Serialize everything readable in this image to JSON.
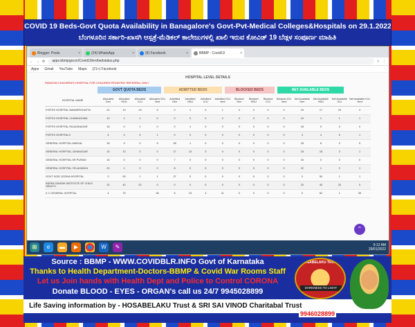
{
  "header": {
    "title": "COVID 19 Beds-Govt Quota Availability in Banagalore's Govt-Pvt-Medical Colleges&Hospitals on 29.1.2022-9.00 AM",
    "subtitle": "ಬೆಂಗಳೂರಿನ ಸರ್ಕಾರಿ-ಖಾಸಗಿ ಆಸ್ಪತ್ರೆ-ಮೆಡಿಕಲ್ ಕಾಲೇಜುಗಳಲ್ಲಿ ಖಾಲಿ ಇರುವ ಕೋವಿಡ್ 19 ಬೆಡ್ಗಳ ಸಂಪೂರ್ಣ ಮಾಹಿತಿ"
  },
  "browser": {
    "tabs": [
      {
        "label": "Blogger: Posts"
      },
      {
        "label": "(24) WhatsApp"
      },
      {
        "label": "(8) Facebook"
      },
      {
        "label": "BBMP - Covid19"
      }
    ],
    "url": "apps.bbmpgov.in/Covid19/en/bedstatus.php",
    "bookmarks": [
      "Apps",
      "Gmail",
      "YouTube",
      "Maps",
      "(21+) Facebook"
    ]
  },
  "page": {
    "section_title": "HOSPITAL LEVEL DETAILS",
    "note": "RANDOM CHILDREN'S HOSPITAL FOR CHILDREN PEDIATRIC REFERRAL ONLY",
    "groups": {
      "govt": "GOVT QUOTA BEDS",
      "admitted": "ADMITTED BEDS",
      "blocked": "BLOCKED BEDS",
      "net": "NET AVAILABLE BEDS"
    },
    "columns": [
      "HOSPITAL NAME",
      "Allocated Gen",
      "Allocated HDU",
      "Allocated ICU",
      "Allocated ICU Vent",
      "Admitted Gen",
      "Admitted HDU",
      "Admitted ICU",
      "Admitted ICU Vent",
      "Blocked Gen",
      "Blocked HDU",
      "Blocked ICU",
      "Blocked ICU Vent",
      "Net Available Gen",
      "Net Available HDU",
      "Net Available ICU",
      "Net Available ICU Vent"
    ],
    "rows": [
      [
        "FORTIS HOSPITAL BANNERGHATTA",
        "22",
        "13",
        "23",
        "5",
        "0",
        "1",
        "0",
        "1",
        "0",
        "0",
        "0",
        "0",
        "23",
        "17",
        "23",
        "4"
      ],
      [
        "FORTIS HOSPITAL CUNNINGHAM",
        "10",
        "1",
        "1",
        "0",
        "0",
        "0",
        "0",
        "0",
        "0",
        "0",
        "0",
        "0",
        "10",
        "1",
        "1",
        "1"
      ],
      [
        "FORTIS HOSPITAL RAJAJINAGAR",
        "18",
        "0",
        "1",
        "0",
        "0",
        "1",
        "0",
        "0",
        "0",
        "0",
        "0",
        "0",
        "18",
        "0",
        "0",
        "0"
      ],
      [
        "FORTIS HOSPITALS",
        "4",
        "4",
        "5",
        "1",
        "0",
        "0",
        "0",
        "0",
        "0",
        "0",
        "0",
        "0",
        "4",
        "4",
        "5",
        "1"
      ],
      [
        "GENERAL HOSPITAL ANEKAL",
        "18",
        "9",
        "0",
        "5",
        "28",
        "1",
        "0",
        "0",
        "0",
        "0",
        "0",
        "0",
        "18",
        "8",
        "0",
        "5"
      ],
      [
        "GENERAL HOSPITAL JAYANAGAR",
        "15",
        "10",
        "3",
        "0",
        "17",
        "14",
        "3",
        "4",
        "0",
        "0",
        "0",
        "0",
        "18",
        "18",
        "3",
        "1"
      ],
      [
        "GENERAL HOSPITAL KR PURAM",
        "16",
        "0",
        "0",
        "0",
        "7",
        "0",
        "0",
        "0",
        "0",
        "0",
        "0",
        "0",
        "16",
        "0",
        "0",
        "0"
      ],
      [
        "GENERAL HOSPITAL YELAHANKA",
        "20",
        "1",
        "0",
        "0",
        "8",
        "0",
        "0",
        "0",
        "0",
        "0",
        "0",
        "0",
        "22",
        "1",
        "0",
        "1"
      ],
      [
        "GOVT KGID GOSHA HOSPITAL",
        "0",
        "50",
        "1",
        "1",
        "27",
        "0",
        "0",
        "0",
        "0",
        "0",
        "0",
        "0",
        "0",
        "50",
        "1",
        "1"
      ],
      [
        "INDIRA GANDHI INSTITUTE OF CHILD HEALTH",
        "20",
        "40",
        "20",
        "0",
        "0",
        "0",
        "0",
        "0",
        "0",
        "0",
        "0",
        "0",
        "20",
        "40",
        "20",
        "0"
      ],
      [
        "K C GENERAL HOSPITAL",
        "4",
        "75",
        "",
        "46",
        "5",
        "13",
        "4",
        "11",
        "0",
        "0",
        "0",
        "0",
        "0",
        "62",
        "1",
        "35"
      ]
    ]
  },
  "taskbar": {
    "time": "9:12 AM",
    "date": "29/01/2022"
  },
  "footer": {
    "line1": "Source : BBMP - WWW.COVIDBLR.INFO  Govt of Karnataka",
    "line2": "Thanks to Health Department-Doctors-BBMP & Covid War Rooms Staff",
    "line3": "Let us Join hands with Health Dept and Police to Control CORONA",
    "line4": "Donate BLOOD - EYES - ORGAN's call us 24/7  9945028899",
    "line5": "Life Saving information by - HOSABELAKU Trust & SRI SAI VINOD Charitabal Trust",
    "logo_text": "HOSABELAKU TRUST",
    "logo_banner": "DARKNESS TO LIGHT",
    "phone": "9946028899"
  },
  "colors": {
    "banner": "#1a2ea0",
    "govt": "#a6cdf0",
    "admitted": "#fde0b0",
    "blocked": "#f6c6c6",
    "net": "#2fd9a7"
  }
}
